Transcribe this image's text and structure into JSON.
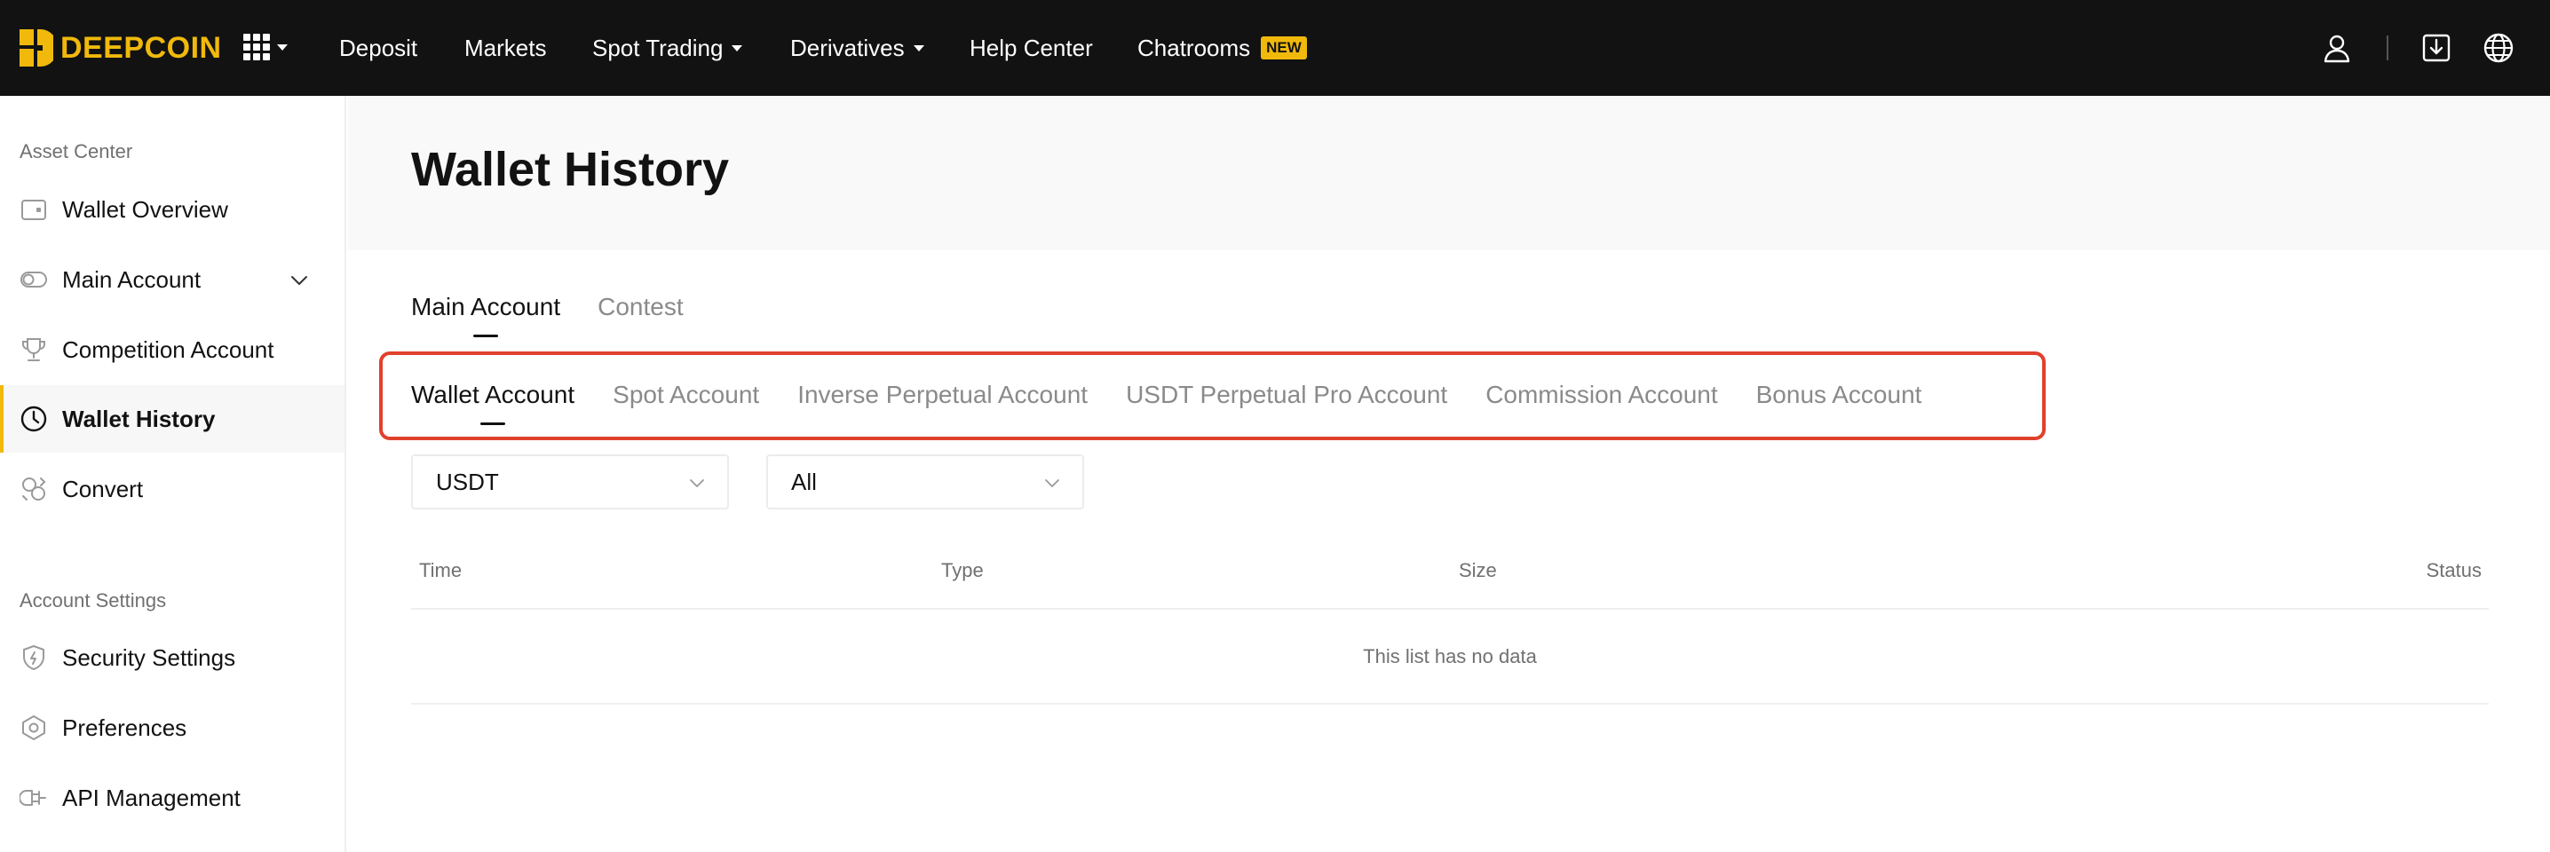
{
  "brand": {
    "name": "DEEPCOIN",
    "color": "#f0b90b"
  },
  "topnav": {
    "items": [
      {
        "label": "Deposit"
      },
      {
        "label": "Markets"
      },
      {
        "label": "Spot Trading",
        "dropdown": true
      },
      {
        "label": "Derivatives",
        "dropdown": true
      },
      {
        "label": "Help Center"
      },
      {
        "label": "Chatrooms",
        "badge": "NEW"
      }
    ],
    "right_icons": [
      "user-icon",
      "download-icon",
      "globe-icon"
    ]
  },
  "sidebar": {
    "sections": [
      {
        "title": "Asset Center",
        "items": [
          {
            "label": "Wallet Overview",
            "icon": "wallet-icon"
          },
          {
            "label": "Main Account",
            "icon": "toggle-icon",
            "expandable": true
          },
          {
            "label": "Competition Account",
            "icon": "trophy-icon"
          },
          {
            "label": "Wallet History",
            "icon": "clock-icon",
            "active": true
          },
          {
            "label": "Convert",
            "icon": "convert-icon"
          }
        ]
      },
      {
        "title": "Account Settings",
        "items": [
          {
            "label": "Security Settings",
            "icon": "shield-icon"
          },
          {
            "label": "Preferences",
            "icon": "hexagon-icon"
          },
          {
            "label": "API Management",
            "icon": "api-icon"
          }
        ]
      }
    ]
  },
  "main": {
    "title": "Wallet History",
    "tabs": [
      {
        "label": "Main Account",
        "active": true
      },
      {
        "label": "Contest",
        "active": false
      }
    ],
    "subtabs": [
      {
        "label": "Wallet Account",
        "active": true
      },
      {
        "label": "Spot Account",
        "active": false
      },
      {
        "label": "Inverse Perpetual Account",
        "active": false
      },
      {
        "label": "USDT Perpetual Pro Account",
        "active": false
      },
      {
        "label": "Commission Account",
        "active": false
      },
      {
        "label": "Bonus Account",
        "active": false
      }
    ],
    "filters": {
      "currency": "USDT",
      "type": "All"
    },
    "table": {
      "columns": [
        "Time",
        "Type",
        "Size",
        "Status"
      ],
      "empty_text": "This list has no data"
    }
  },
  "highlight_color": "#e0412c"
}
